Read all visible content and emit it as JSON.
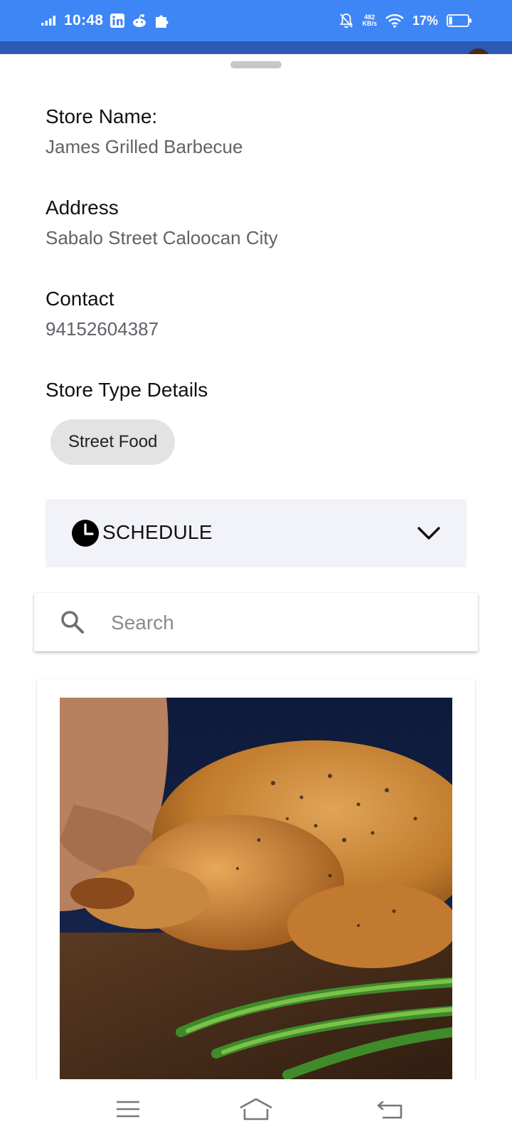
{
  "status_bar": {
    "time": "10:48",
    "net_speed_value": "482",
    "net_speed_unit": "KB/s",
    "battery": "17%",
    "battery_level": 0.17,
    "background": "#3e86f6"
  },
  "store": {
    "name_label": "Store Name:",
    "name_value": "James Grilled Barbecue",
    "address_label": "Address",
    "address_value": "Sabalo Street Caloocan City",
    "contact_label": "Contact",
    "contact_value": "94152604387",
    "type_label": "Store Type Details",
    "type_chips": [
      "Street Food"
    ]
  },
  "schedule": {
    "label": "SCHEDULE",
    "icon": "clock-icon",
    "toggle_icon": "chevron-down-icon"
  },
  "search": {
    "placeholder": "Search",
    "value": "",
    "icon": "search-icon"
  },
  "products": [
    {
      "image": "roast-chicken-photo"
    }
  ],
  "nav_bar": {
    "items": [
      "menu-icon",
      "home-icon",
      "back-icon"
    ]
  }
}
